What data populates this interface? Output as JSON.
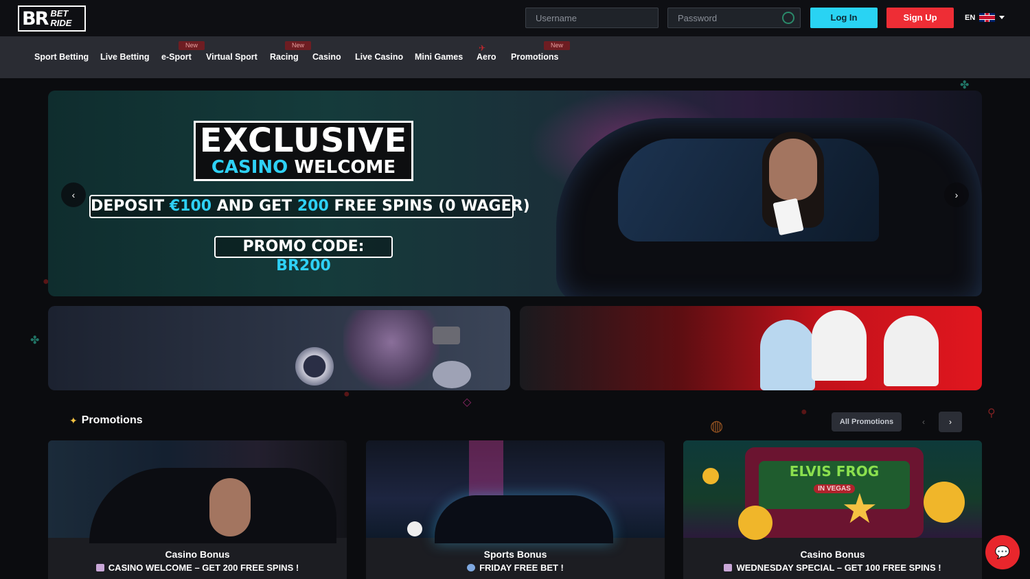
{
  "header": {
    "logo_big": "BR",
    "logo_top": "BET",
    "logo_bottom": "RIDE",
    "username_placeholder": "Username",
    "password_placeholder": "Password",
    "login_label": "Log In",
    "signup_label": "Sign Up",
    "lang": "EN"
  },
  "nav": {
    "items": [
      {
        "label": "Sport Betting",
        "new": false
      },
      {
        "label": "Live Betting",
        "new": false
      },
      {
        "label": "e-Sport",
        "new": true
      },
      {
        "label": "Virtual Sport",
        "new": false
      },
      {
        "label": "Racing",
        "new": true
      },
      {
        "label": "Casino",
        "new": false
      },
      {
        "label": "Live Casino",
        "new": false
      },
      {
        "label": "Mini Games",
        "new": false
      },
      {
        "label": "Aero",
        "new": false
      },
      {
        "label": "Promotions",
        "new": true
      }
    ],
    "new_label": "New"
  },
  "hero": {
    "line1": "EXCLUSIVE",
    "line2a": "CASINO",
    "line2b": "WELCOME",
    "deposit_a": "DEPOSIT",
    "deposit_b": "€100",
    "deposit_c": "AND GET",
    "deposit_d": "200",
    "deposit_e": "FREE SPINS (0 WAGER)",
    "promo_a": "PROMO CODE:",
    "promo_b": "BR200",
    "prev": "‹",
    "next": "›"
  },
  "promotions": {
    "title": "Promotions",
    "all_label": "All Promotions",
    "prev": "‹",
    "next": "›",
    "cards": [
      {
        "title": "Casino Bonus",
        "subtitle": "CASINO WELCOME – GET 200 FREE SPINS !"
      },
      {
        "title": "Sports Bonus",
        "subtitle": "FRIDAY FREE BET !"
      },
      {
        "title": "Casino Bonus",
        "subtitle": "WEDNESDAY SPECIAL – GET 100 FREE SPINS !"
      }
    ],
    "card3_art_title": "ELVIS FROG",
    "card3_art_sub": "IN VEGAS"
  },
  "colors": {
    "accent_cyan": "#2ed0f5",
    "signup_red": "#ee2d35",
    "login_cyan": "#29d3f3"
  }
}
